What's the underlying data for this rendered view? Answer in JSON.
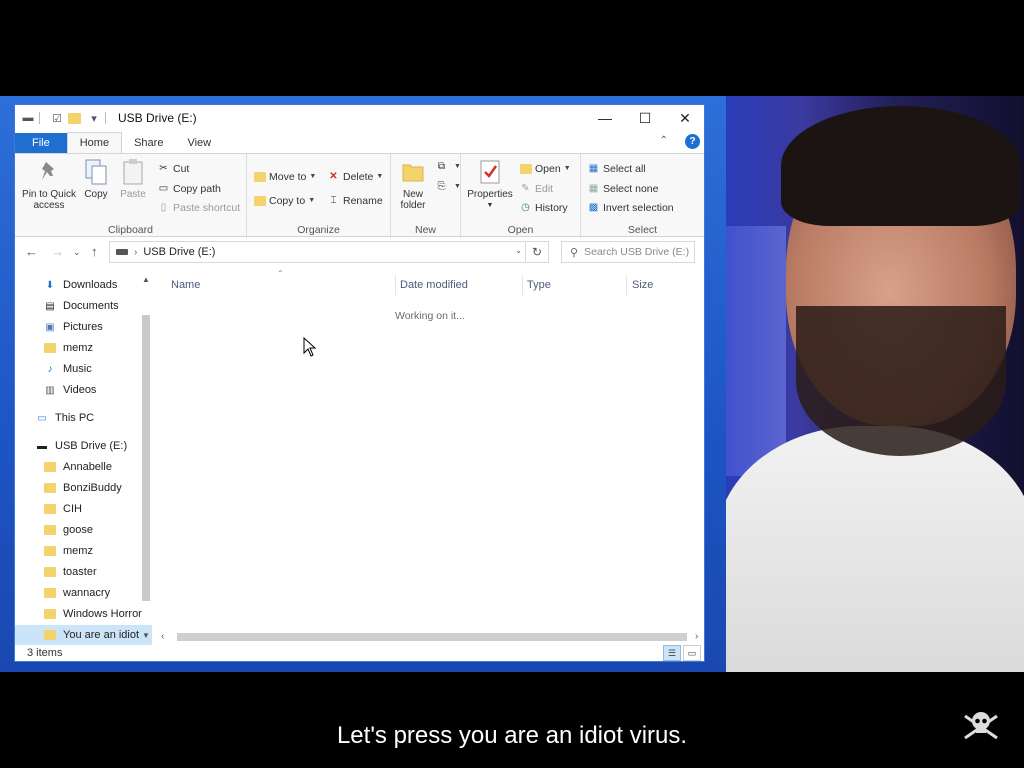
{
  "window": {
    "title": "USB Drive (E:)",
    "minimize_glyph": "—",
    "maximize_glyph": "☐",
    "close_glyph": "✕"
  },
  "ribbon": {
    "tabs": [
      "File",
      "Home",
      "Share",
      "View"
    ],
    "active_tab": "Home",
    "help": "?",
    "clipboard": {
      "label": "Clipboard",
      "pin_to_quick_access": "Pin to Quick access",
      "copy": "Copy",
      "paste": "Paste",
      "cut": "Cut",
      "copy_path": "Copy path",
      "paste_shortcut": "Paste shortcut"
    },
    "organize": {
      "label": "Organize",
      "move_to": "Move to",
      "copy_to": "Copy to",
      "delete": "Delete",
      "rename": "Rename"
    },
    "new": {
      "label": "New",
      "new_folder": "New folder"
    },
    "open": {
      "label": "Open",
      "properties": "Properties",
      "open": "Open",
      "edit": "Edit",
      "history": "History"
    },
    "select": {
      "label": "Select",
      "select_all": "Select all",
      "select_none": "Select none",
      "invert_selection": "Invert selection"
    }
  },
  "address_bar": {
    "path": "USB Drive (E:)",
    "search_placeholder": "Search USB Drive (E:)"
  },
  "nav_pane": {
    "quick_access": [
      {
        "label": "Downloads",
        "pinned": true,
        "icon": "download-arrow-icon"
      },
      {
        "label": "Documents",
        "pinned": true,
        "icon": "document-icon"
      },
      {
        "label": "Pictures",
        "pinned": true,
        "icon": "picture-icon"
      },
      {
        "label": "memz",
        "pinned": false,
        "icon": "folder-icon"
      },
      {
        "label": "Music",
        "pinned": false,
        "icon": "music-note-icon"
      },
      {
        "label": "Videos",
        "pinned": false,
        "icon": "video-icon"
      }
    ],
    "this_pc": "This PC",
    "usb_drive": "USB Drive (E:)",
    "usb_folders": [
      "Annabelle",
      "BonziBuddy",
      "CIH",
      "goose",
      "memz",
      "toaster",
      "wannacry",
      "Windows Horror",
      "You are an idiot"
    ],
    "selected_item": "You are an idiot"
  },
  "file_list": {
    "columns": [
      "Name",
      "Date modified",
      "Type",
      "Size"
    ],
    "status_message": "Working on it..."
  },
  "status_bar": {
    "item_count": "3 items"
  },
  "caption": {
    "text": "Let's press you are an idiot virus."
  },
  "colors": {
    "accent": "#1f6fd1",
    "selection": "#cce4f7",
    "folder": "#f4d36c"
  }
}
